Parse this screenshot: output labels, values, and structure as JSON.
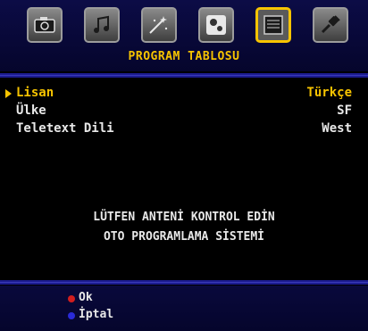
{
  "header": {
    "title": "PROGRAM TABLOSU",
    "icons": [
      "picture-icon",
      "sound-icon",
      "feature-icon",
      "setup-icon",
      "program-table-icon",
      "source-icon"
    ],
    "selected_index": 4
  },
  "menu": {
    "items": [
      {
        "label": "Lisan",
        "value": "Türkçe"
      },
      {
        "label": "Ülke",
        "value": "SF"
      },
      {
        "label": "Teletext Dili",
        "value": "West"
      }
    ],
    "selected_index": 0
  },
  "messages": {
    "line1": "LÜTFEN ANTENİ KONTROL EDİN",
    "line2": "OTO PROGRAMLAMA SİSTEMİ"
  },
  "legend": {
    "ok_label": "Ok",
    "cancel_label": "İptal",
    "ok_color": "#d21e1e",
    "cancel_color": "#2a2ad8"
  },
  "colors": {
    "accent": "#f7c400",
    "text": "#e8e8e8",
    "panel": "#0c0c46"
  }
}
